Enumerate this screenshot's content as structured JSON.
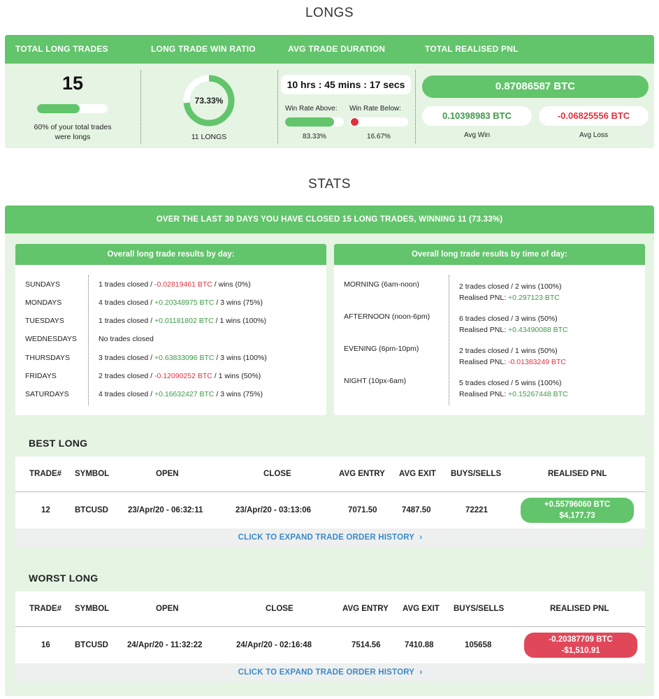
{
  "longs": {
    "title": "LONGS",
    "headers": [
      "TOTAL LONG TRADES",
      "LONG TRADE WIN RATIO",
      "AVG TRADE DURATION",
      "TOTAL REALISED PNL"
    ],
    "total_trades": "15",
    "total_progress": 0.6,
    "total_caption_1": "60% of your total trades",
    "total_caption_2": "were longs",
    "win_ratio_label": "73.33%",
    "win_ratio_value": 0.7333,
    "win_longs_label": "11 LONGS",
    "duration": "10 hrs : 45 mins : 17 secs",
    "win_rate_above_label": "Win Rate Above:",
    "win_rate_below_label": "Win Rate Below:",
    "win_rate_above_value": "83.33%",
    "win_rate_below_value": "16.67%",
    "win_rate_above_fraction": 0.8333,
    "total_pnl": "0.87086587 BTC",
    "avg_win": "0.10398983 BTC",
    "avg_loss": "-0.06825556 BTC",
    "avg_win_label": "Avg Win",
    "avg_loss_label": "Avg Loss"
  },
  "stats": {
    "title": "STATS",
    "banner": "OVER THE LAST 30 DAYS YOU HAVE CLOSED 15 LONG TRADES, WINNING 11 (73.33%)",
    "by_day_title": "Overall long trade results by day:",
    "by_time_title": "Overall long trade results by time of day:",
    "days": [
      {
        "name": "SUNDAYS",
        "pre": "1 trades closed / ",
        "pnl": "-0.02819461 BTC",
        "post": " / wins (0%)",
        "sign": "neg"
      },
      {
        "name": "MONDAYS",
        "pre": "4 trades closed / ",
        "pnl": "+0.20348975 BTC",
        "post": " / 3 wins (75%)",
        "sign": "pos"
      },
      {
        "name": "TUESDAYS",
        "pre": "1 trades closed / ",
        "pnl": "+0.01181802 BTC",
        "post": " / 1 wins (100%)",
        "sign": "pos"
      },
      {
        "name": "WEDNESDAYS",
        "pre": "No trades closed",
        "pnl": "",
        "post": "",
        "sign": "none"
      },
      {
        "name": "THURSDAYS",
        "pre": "3 trades closed / ",
        "pnl": "+0.63833096 BTC",
        "post": " / 3 wins (100%)",
        "sign": "pos"
      },
      {
        "name": "FRIDAYS",
        "pre": "2 trades closed / ",
        "pnl": "-0.12090252 BTC",
        "post": " / 1 wins (50%)",
        "sign": "neg"
      },
      {
        "name": "SATURDAYS",
        "pre": "4 trades closed / ",
        "pnl": "+0.16632427 BTC",
        "post": " / 3 wins (75%)",
        "sign": "pos"
      }
    ],
    "times": [
      {
        "name": "MORNING (6am-noon)",
        "line1": "2 trades closed / 2 wins (100%)",
        "pnl_label": "Realised PNL: ",
        "pnl": "+0.297123 BTC",
        "sign": "pos"
      },
      {
        "name": "AFTERNOON (noon-6pm)",
        "line1": "6 trades closed / 3 wins (50%)",
        "pnl_label": "Realised PNL: ",
        "pnl": "+0.43490088 BTC",
        "sign": "pos"
      },
      {
        "name": "EVENING (6pm-10pm)",
        "line1": "2 trades closed / 1 wins (50%)",
        "pnl_label": "Realised PNL: ",
        "pnl": "-0.01383249 BTC",
        "sign": "neg"
      },
      {
        "name": "NIGHT (10px-6am)",
        "line1": "5 trades closed / 5 wins (100%)",
        "pnl_label": "Realised PNL: ",
        "pnl": "+0.15267448 BTC",
        "sign": "pos"
      }
    ],
    "columns": [
      "TRADE#",
      "SYMBOL",
      "OPEN",
      "CLOSE",
      "AVG ENTRY",
      "AVG EXIT",
      "BUYS/SELLS",
      "REALISED PNL"
    ],
    "best": {
      "title": "BEST LONG",
      "trade": "12",
      "symbol": "BTCUSD",
      "open": "23/Apr/20 - 06:32:11",
      "close": "23/Apr/20 - 03:13:06",
      "avg_entry": "7071.50",
      "avg_exit": "7487.50",
      "buys_sells": "72221",
      "pnl_btc": "+0.55796060 BTC",
      "pnl_usd": "$4,177.73"
    },
    "worst": {
      "title": "WORST LONG",
      "trade": "16",
      "symbol": "BTCUSD",
      "open": "24/Apr/20 - 11:32:22",
      "close": "24/Apr/20 - 02:16:48",
      "avg_entry": "7514.56",
      "avg_exit": "7410.88",
      "buys_sells": "105658",
      "pnl_btc": "-0.20387709 BTC",
      "pnl_usd": "-$1,510.91"
    },
    "expand_label": "CLICK TO EXPAND TRADE ORDER HISTORY",
    "expand_icon": "chevron-right-icon"
  },
  "colors": {
    "green": "#62c46b",
    "light_green_bg": "#e5f4e3",
    "positive": "#3d9a45",
    "negative": "#e0313f",
    "link": "#3b8ac9"
  }
}
